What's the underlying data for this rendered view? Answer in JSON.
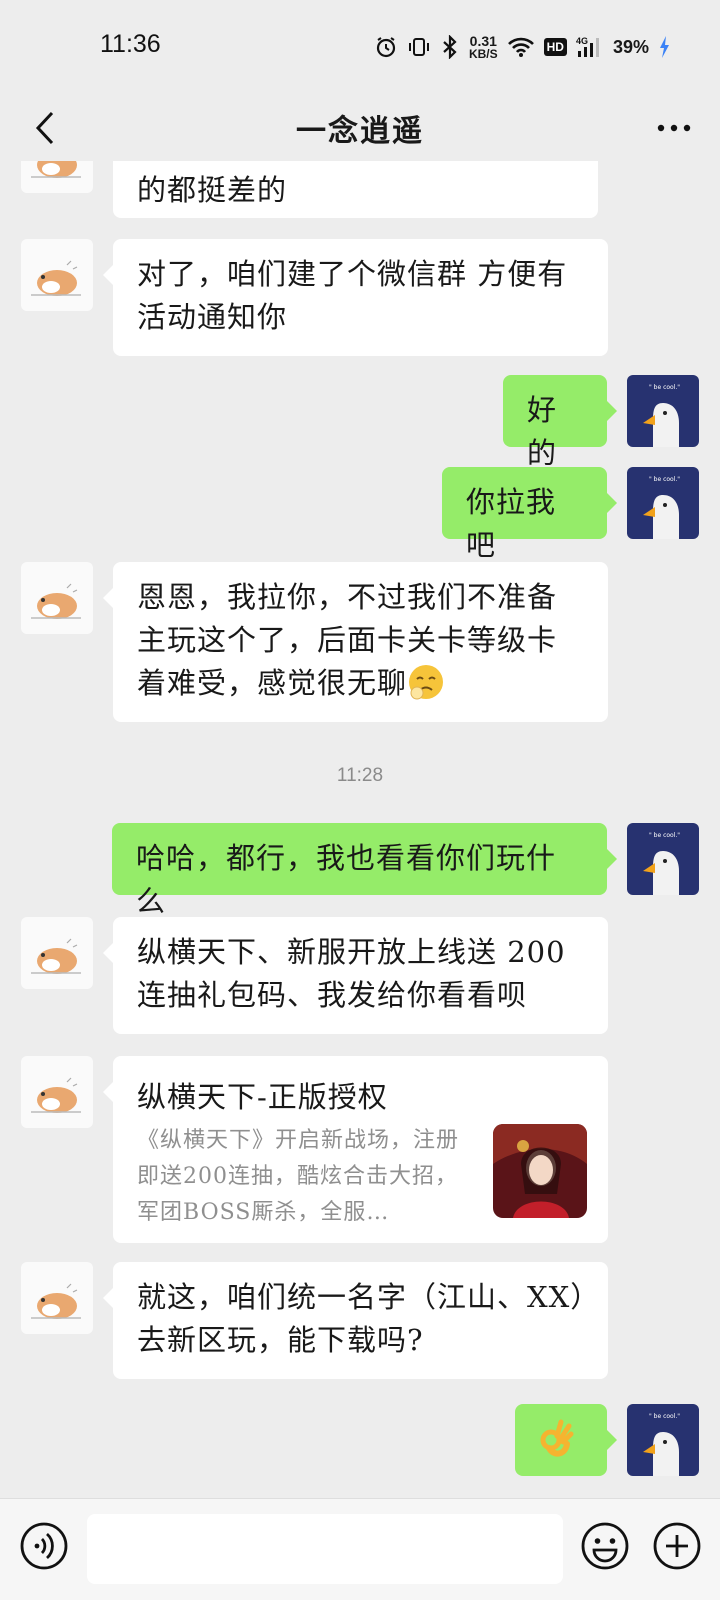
{
  "status_bar": {
    "time": "11:36",
    "net_speed_value": "0.31",
    "net_speed_unit": "KB/S",
    "hd_label": "HD",
    "network_label": "4G",
    "battery_percent": "39%",
    "icons": [
      "alarm-icon",
      "vibrate-icon",
      "bluetooth-icon",
      "wifi-icon",
      "signal-icon",
      "battery-charging-icon"
    ]
  },
  "header": {
    "title": "一念逍遥",
    "back_icon": "chevron-left-icon",
    "more_icon": "more-dots-icon"
  },
  "messages": [
    {
      "sender": "contact",
      "text": "的都挺差的"
    },
    {
      "sender": "contact",
      "text": "对了，咱们建了个微信群 方便有活动通知你"
    },
    {
      "sender": "me",
      "text": "好的"
    },
    {
      "sender": "me",
      "text": "你拉我吧"
    },
    {
      "sender": "contact",
      "text": "恩恩，我拉你，不过我们不准备主玩这个了，后面卡关卡等级卡着难受，感觉很无聊",
      "emoji": "tired-face-emoji"
    },
    {
      "type": "timestamp",
      "text": "11:28"
    },
    {
      "sender": "me",
      "text": "哈哈，都行，我也看看你们玩什么"
    },
    {
      "sender": "contact",
      "text": "纵横天下、新服开放上线送 200 连抽礼包码、我发给你看看呗"
    },
    {
      "sender": "contact",
      "type": "link_card",
      "title": "纵横天下-正版授权",
      "description": "《纵横天下》开启新战场，注册即送200连抽，酷炫合击大招，军团BOSS厮杀，全服…"
    },
    {
      "sender": "contact",
      "text": "就这，咱们统一名字（江山、XX）去新区玩，能下载吗?"
    },
    {
      "sender": "me",
      "emoji": "ok-hand-emoji",
      "text": "👌"
    }
  ],
  "input_bar": {
    "placeholder": "",
    "value": "",
    "icons": [
      "voice-icon",
      "emoji-icon",
      "plus-icon"
    ]
  },
  "colors": {
    "background": "#ededed",
    "outgoing_bubble": "#95ec69",
    "incoming_bubble": "#ffffff",
    "duck_avatar_bg": "#273270"
  }
}
